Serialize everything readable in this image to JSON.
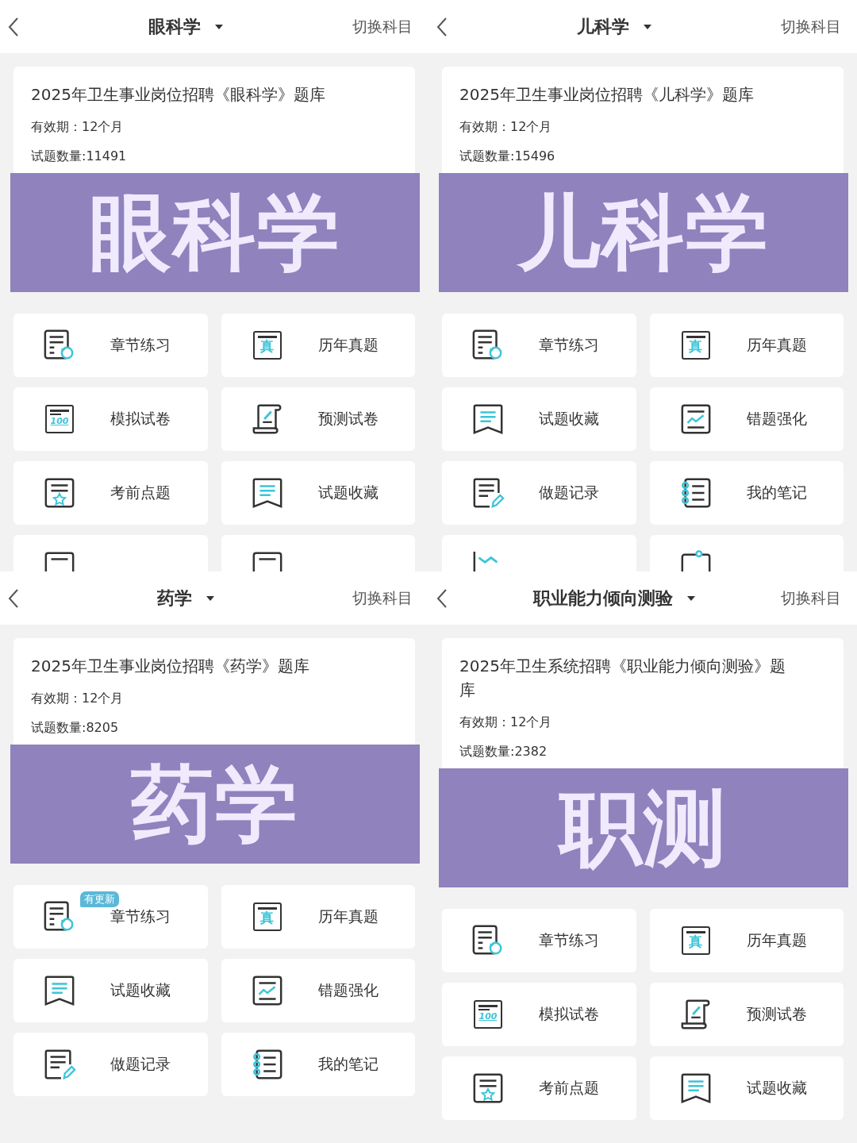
{
  "panels": [
    {
      "header": {
        "title": "眼科学",
        "switch": "切换科目"
      },
      "card": {
        "title": "2025年卫生事业岗位招聘《眼科学》题库",
        "validity": "有效期：12个月",
        "count": "试题数量:11491"
      },
      "banner": "眼科学",
      "tiles": [
        {
          "kind": "practice",
          "label": "章节练习"
        },
        {
          "kind": "real",
          "glyph": "真",
          "label": "历年真题"
        },
        {
          "kind": "mock",
          "glyph": "100",
          "label": "模拟试卷"
        },
        {
          "kind": "scroll",
          "label": "预测试卷"
        },
        {
          "kind": "star",
          "label": "考前点题"
        },
        {
          "kind": "bookmark",
          "label": "试题收藏"
        },
        {
          "kind": "doc"
        },
        {
          "kind": "doc"
        }
      ]
    },
    {
      "header": {
        "title": "儿科学",
        "switch": "切换科目"
      },
      "card": {
        "title": "2025年卫生事业岗位招聘《儿科学》题库",
        "validity": "有效期：12个月",
        "count": "试题数量:15496"
      },
      "banner": "儿科学",
      "tiles": [
        {
          "kind": "practice",
          "label": "章节练习"
        },
        {
          "kind": "real",
          "glyph": "真",
          "label": "历年真题"
        },
        {
          "kind": "bookmark",
          "label": "试题收藏"
        },
        {
          "kind": "chart",
          "label": "错题强化"
        },
        {
          "kind": "pen",
          "label": "做题记录"
        },
        {
          "kind": "notebook",
          "label": "我的笔记"
        },
        {
          "kind": "trend"
        },
        {
          "kind": "clip"
        }
      ]
    },
    {
      "header": {
        "title": "药学",
        "switch": "切换科目"
      },
      "card": {
        "title": "2025年卫生事业岗位招聘《药学》题库",
        "validity": "有效期：12个月",
        "count": "试题数量:8205"
      },
      "banner": "药学",
      "tiles": [
        {
          "kind": "practice",
          "badge": "有更新",
          "label": "章节练习"
        },
        {
          "kind": "real",
          "glyph": "真",
          "label": "历年真题"
        },
        {
          "kind": "bookmark",
          "label": "试题收藏"
        },
        {
          "kind": "chart",
          "label": "错题强化"
        },
        {
          "kind": "pen",
          "label": "做题记录"
        },
        {
          "kind": "notebook",
          "label": "我的笔记"
        }
      ]
    },
    {
      "header": {
        "title": "职业能力倾向测验",
        "switch": "切换科目"
      },
      "card": {
        "title": "2025年卫生系统招聘《职业能力倾向测验》题库",
        "validity": "有效期：12个月",
        "count": "试题数量:2382"
      },
      "banner": "职测",
      "tiles": [
        {
          "kind": "practice",
          "label": "章节练习"
        },
        {
          "kind": "real",
          "glyph": "真",
          "label": "历年真题"
        },
        {
          "kind": "mock",
          "glyph": "100",
          "label": "模拟试卷"
        },
        {
          "kind": "scroll",
          "label": "预测试卷"
        },
        {
          "kind": "star",
          "label": "考前点题"
        },
        {
          "kind": "bookmark",
          "label": "试题收藏"
        }
      ]
    }
  ]
}
